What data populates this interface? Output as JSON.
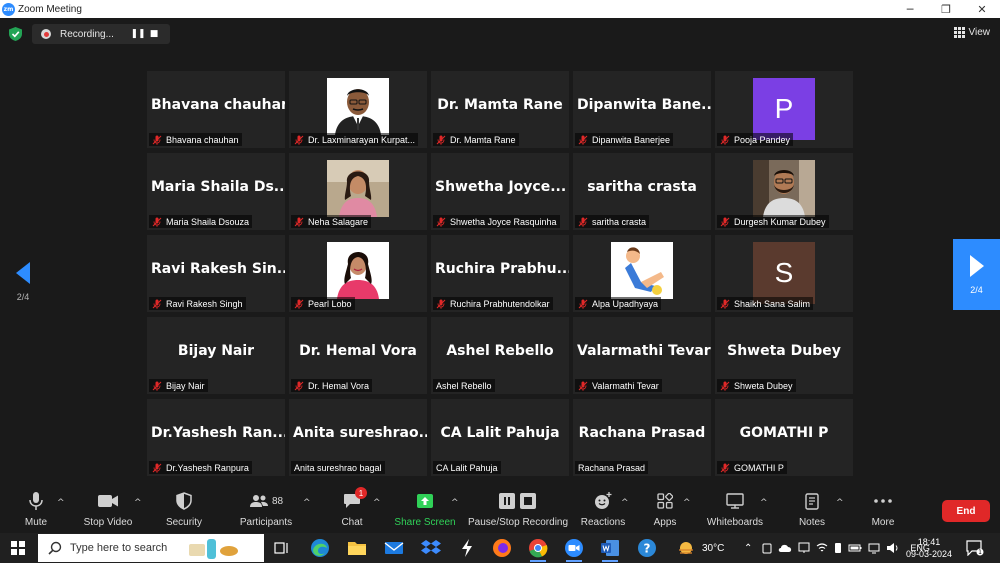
{
  "window": {
    "title": "Zoom Meeting",
    "logo_text": "zm",
    "minimize": "─",
    "restore": "❐",
    "close": "✕"
  },
  "meeting_bar": {
    "recording_label": "Recording...",
    "pause_glyph": "❚❚",
    "stop_glyph": "■",
    "view_label": "View"
  },
  "tiles": [
    {
      "display": "Bhavana chauhan",
      "label": "Bhavana chauhan",
      "muted": true,
      "type": "text"
    },
    {
      "display": "",
      "label": "Dr. Laxminarayan Kurpat...",
      "muted": true,
      "type": "photo",
      "photo": "man-suit"
    },
    {
      "display": "Dr. Mamta Rane",
      "label": "Dr. Mamta Rane",
      "muted": true,
      "type": "text"
    },
    {
      "display": "Dipanwita  Bane...",
      "label": "Dipanwita Banerjee",
      "muted": true,
      "type": "text"
    },
    {
      "display": "P",
      "label": "Pooja Pandey",
      "muted": true,
      "type": "letter",
      "color": "#7b3fe4"
    },
    {
      "display": "Maria Shaila Ds...",
      "label": "Maria Shaila Dsouza",
      "muted": true,
      "type": "text"
    },
    {
      "display": "",
      "label": "Neha Salagare",
      "muted": true,
      "type": "photo",
      "photo": "woman-outdoor"
    },
    {
      "display": "Shwetha  Joyce...",
      "label": "Shwetha Joyce Rasquinha",
      "muted": true,
      "type": "text"
    },
    {
      "display": "saritha crasta",
      "label": "saritha crasta",
      "muted": true,
      "type": "text"
    },
    {
      "display": "",
      "label": "Durgesh Kumar Dubey",
      "muted": true,
      "type": "photo",
      "photo": "man-beard"
    },
    {
      "display": "Ravi Rakesh Sin...",
      "label": "Ravi Rakesh Singh",
      "muted": true,
      "type": "text"
    },
    {
      "display": "",
      "label": "Pearl Lobo",
      "muted": true,
      "type": "photo",
      "photo": "woman-pink"
    },
    {
      "display": "Ruchira  Prabhu...",
      "label": "Ruchira Prabhutendolkar",
      "muted": true,
      "type": "text"
    },
    {
      "display": "",
      "label": "Alpa Upadhyaya",
      "muted": true,
      "type": "photo",
      "photo": "cartoon"
    },
    {
      "display": "S",
      "label": "Shaikh Sana Salim",
      "muted": true,
      "type": "letter",
      "color": "#5a3a2e"
    },
    {
      "display": "Bijay Nair",
      "label": "Bijay Nair",
      "muted": true,
      "type": "text"
    },
    {
      "display": "Dr. Hemal Vora",
      "label": "Dr. Hemal Vora",
      "muted": true,
      "type": "text"
    },
    {
      "display": "Ashel Rebello",
      "label": "Ashel Rebello",
      "muted": false,
      "type": "text"
    },
    {
      "display": "Valarmathi Tevar",
      "label": "Valarmathi Tevar",
      "muted": true,
      "type": "text"
    },
    {
      "display": "Shweta Dubey",
      "label": "Shweta Dubey",
      "muted": true,
      "type": "text"
    },
    {
      "display": "Dr.Yashesh  Ran...",
      "label": "Dr.Yashesh Ranpura",
      "muted": true,
      "type": "text"
    },
    {
      "display": "Anita  sureshrao...",
      "label": "Anita sureshrao bagal",
      "muted": false,
      "type": "text"
    },
    {
      "display": "CA Lalit Pahuja",
      "label": "CA Lalit Pahuja",
      "muted": false,
      "type": "text"
    },
    {
      "display": "Rachana Prasad",
      "label": "Rachana Prasad",
      "muted": false,
      "type": "text"
    },
    {
      "display": "GOMATHI P",
      "label": "GOMATHI P",
      "muted": true,
      "type": "text"
    }
  ],
  "pagination": {
    "left": "2/4",
    "right": "2/4"
  },
  "toolbar": {
    "mute": "Mute",
    "stop_video": "Stop Video",
    "security": "Security",
    "participants": "Participants",
    "participants_count": "88",
    "chat": "Chat",
    "chat_badge": "1",
    "share_screen": "Share Screen",
    "recording": "Pause/Stop Recording",
    "reactions": "Reactions",
    "apps": "Apps",
    "whiteboards": "Whiteboards",
    "notes": "Notes",
    "more": "More",
    "end": "End"
  },
  "taskbar": {
    "search_placeholder": "Type here to search",
    "weather": "30°C",
    "language": "ENG",
    "time": "18:41",
    "date": "09-03-2024",
    "notification_count": "1"
  },
  "colors": {
    "accent": "#2d8cff",
    "end": "#e02828",
    "share": "#30d158",
    "muted_icon": "#e02828"
  }
}
